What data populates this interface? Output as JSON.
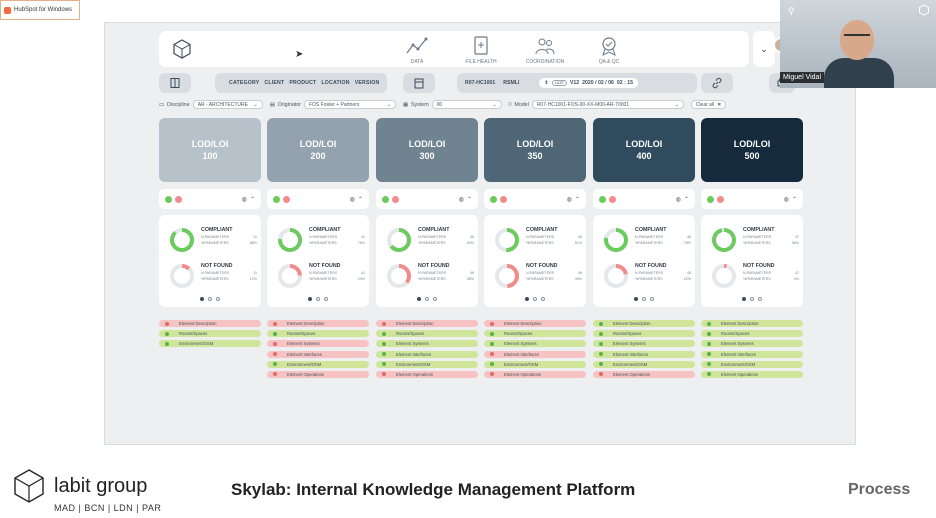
{
  "taskbar_app": {
    "label": "HubSpot for Windows"
  },
  "nav": [
    {
      "label": "DATA",
      "icon": "line-chart-icon"
    },
    {
      "label": "FILE HEALTH",
      "icon": "file-health-icon"
    },
    {
      "label": "COORDINATION",
      "icon": "people-icon"
    },
    {
      "label": "QA & QC",
      "icon": "badge-icon"
    }
  ],
  "category_links": [
    "CATEGORY",
    "CLIENT",
    "PRODUCT",
    "LOCATION",
    "VERSION"
  ],
  "version": {
    "code": "R07-HC1001",
    "sub": "RSMLI",
    "last_tag": "LAST",
    "ver": "V12",
    "date": "2020 / 02 / 06",
    "time": "02 : 15"
  },
  "filters": {
    "discipline_label": "Discipline",
    "discipline_value": "AR - ARCHITECTURE",
    "originator_label": "Originator",
    "originator_value": "FOS Foster + Partners",
    "system_label": "System",
    "system_value": "00",
    "model_label": "Model",
    "model_value": "R07-HC1001-FOS-00-XX-M00-AR-70001",
    "clear_label": "Clear all"
  },
  "lod_cards": [
    {
      "title": "LOD/LOI",
      "level": "100",
      "color": "#b7c1c9"
    },
    {
      "title": "LOD/LOI",
      "level": "200",
      "color": "#93a2ae"
    },
    {
      "title": "LOD/LOI",
      "level": "300",
      "color": "#6f8391"
    },
    {
      "title": "LOD/LOI",
      "level": "350",
      "color": "#4e6676"
    },
    {
      "title": "LOD/LOI",
      "level": "400",
      "color": "#2f4b5d"
    },
    {
      "title": "LOD/LOI",
      "level": "500",
      "color": "#152a3c"
    }
  ],
  "metrics": [
    {
      "compliant_title": "COMPLIANT",
      "n_label": "N.PARAMETERS",
      "n": "11",
      "pct_label": "%PARAMETERS",
      "pct": "88%",
      "nf_title": "NOT FOUND",
      "nf_n": "11",
      "nf_pct": "12%",
      "compliant_fraction": 0.88
    },
    {
      "compliant_title": "COMPLIANT",
      "n_label": "N.PARAMETERS",
      "n": "41",
      "pct_label": "%PARAMETERS",
      "pct": "76%",
      "nf_title": "NOT FOUND",
      "nf_n": "41",
      "nf_pct": "24%",
      "compliant_fraction": 0.76
    },
    {
      "compliant_title": "COMPLIANT",
      "n_label": "N.PARAMETERS",
      "n": "46",
      "pct_label": "%PARAMETERS",
      "pct": "64%",
      "nf_title": "NOT FOUND",
      "nf_n": "46",
      "nf_pct": "36%",
      "compliant_fraction": 0.64
    },
    {
      "compliant_title": "COMPLIANT",
      "n_label": "N.PARAMETERS",
      "n": "46",
      "pct_label": "%PARAMETERS",
      "pct": "51%",
      "nf_title": "NOT FOUND",
      "nf_n": "46",
      "nf_pct": "49%",
      "compliant_fraction": 0.51
    },
    {
      "compliant_title": "COMPLIANT",
      "n_label": "N.PARAMETERS",
      "n": "48",
      "pct_label": "%PARAMETERS",
      "pct": "78%",
      "nf_title": "NOT FOUND",
      "nf_n": "48",
      "nf_pct": "22%",
      "compliant_fraction": 0.78
    },
    {
      "compliant_title": "COMPLIANT",
      "n_label": "N.PARAMETERS",
      "n": "47",
      "pct_label": "%PARAMETERS",
      "pct": "96%",
      "nf_title": "NOT FOUND",
      "nf_n": "47",
      "nf_pct": "4%",
      "compliant_fraction": 0.96
    }
  ],
  "element_lists": [
    [
      {
        "label": "Element Description",
        "status": "red"
      },
      {
        "label": "Rooms/Spaces",
        "status": "green"
      },
      {
        "label": "Environment/OSM",
        "status": "green"
      }
    ],
    [
      {
        "label": "Element Description",
        "status": "red"
      },
      {
        "label": "Rooms/Spaces",
        "status": "green"
      },
      {
        "label": "Element Systems",
        "status": "red"
      },
      {
        "label": "Element Interfaces",
        "status": "red"
      },
      {
        "label": "Environment/OSM",
        "status": "green"
      },
      {
        "label": "Element Operations",
        "status": "red"
      }
    ],
    [
      {
        "label": "Element Description",
        "status": "red"
      },
      {
        "label": "Rooms/Spaces",
        "status": "green"
      },
      {
        "label": "Element Systems",
        "status": "green"
      },
      {
        "label": "Element Interfaces",
        "status": "green"
      },
      {
        "label": "Environment/OSM",
        "status": "green"
      },
      {
        "label": "Element Operations",
        "status": "red"
      }
    ],
    [
      {
        "label": "Element Description",
        "status": "red"
      },
      {
        "label": "Rooms/Spaces",
        "status": "green"
      },
      {
        "label": "Element Systems",
        "status": "green"
      },
      {
        "label": "Element Interfaces",
        "status": "red"
      },
      {
        "label": "Environment/OSM",
        "status": "green"
      },
      {
        "label": "Element Operations",
        "status": "red"
      }
    ],
    [
      {
        "label": "Element Description",
        "status": "green"
      },
      {
        "label": "Rooms/Spaces",
        "status": "green"
      },
      {
        "label": "Element Systems",
        "status": "green"
      },
      {
        "label": "Element Interfaces",
        "status": "green"
      },
      {
        "label": "Environment/OSM",
        "status": "green"
      },
      {
        "label": "Element Operations",
        "status": "red"
      }
    ],
    [
      {
        "label": "Element Description",
        "status": "green"
      },
      {
        "label": "Rooms/Spaces",
        "status": "green"
      },
      {
        "label": "Element Systems",
        "status": "green"
      },
      {
        "label": "Element Interfaces",
        "status": "green"
      },
      {
        "label": "Environment/OSM",
        "status": "green"
      },
      {
        "label": "Element Operations",
        "status": "green"
      }
    ]
  ],
  "video": {
    "name": "Miguel Vidal"
  },
  "footer": {
    "brand_a": "labit",
    "brand_b": "group",
    "offices": "MAD | BCN | LDN | PAR",
    "title": "Skylab: Internal Knowledge Management Platform",
    "section": "Process"
  }
}
